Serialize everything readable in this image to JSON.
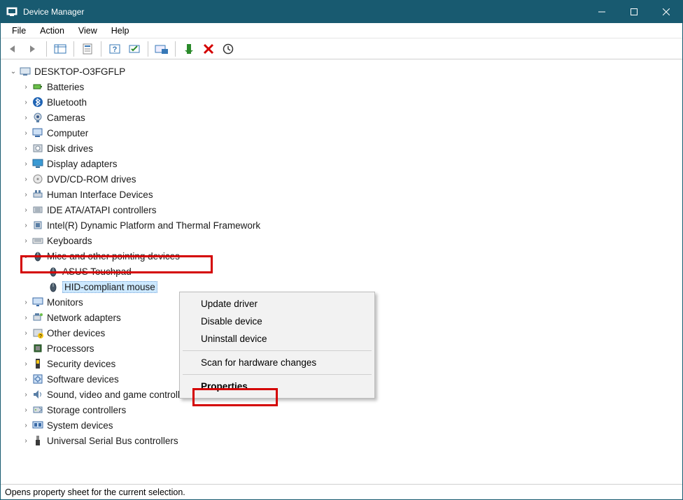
{
  "window": {
    "title": "Device Manager"
  },
  "menu": [
    "File",
    "Action",
    "View",
    "Help"
  ],
  "statusbar": "Opens property sheet for the current selection.",
  "root": {
    "label": "DESKTOP-O3FGFLP",
    "expanded": true
  },
  "categories": [
    {
      "label": "Batteries",
      "icon": "battery"
    },
    {
      "label": "Bluetooth",
      "icon": "bluetooth"
    },
    {
      "label": "Cameras",
      "icon": "camera"
    },
    {
      "label": "Computer",
      "icon": "computer"
    },
    {
      "label": "Disk drives",
      "icon": "disk"
    },
    {
      "label": "Display adapters",
      "icon": "display"
    },
    {
      "label": "DVD/CD-ROM drives",
      "icon": "dvd"
    },
    {
      "label": "Human Interface Devices",
      "icon": "hid"
    },
    {
      "label": "IDE ATA/ATAPI controllers",
      "icon": "ide"
    },
    {
      "label": "Intel(R) Dynamic Platform and Thermal Framework",
      "icon": "chip"
    },
    {
      "label": "Keyboards",
      "icon": "keyboard"
    },
    {
      "label": "Mice and other pointing devices",
      "icon": "mouse",
      "expanded": true,
      "highlighted": true,
      "children": [
        {
          "label": "ASUS Touchpad",
          "icon": "mouse"
        },
        {
          "label": "HID-compliant mouse",
          "icon": "mouse",
          "selected": true
        }
      ]
    },
    {
      "label": "Monitors",
      "icon": "monitor"
    },
    {
      "label": "Network adapters",
      "icon": "network"
    },
    {
      "label": "Other devices",
      "icon": "other"
    },
    {
      "label": "Processors",
      "icon": "cpu"
    },
    {
      "label": "Security devices",
      "icon": "security"
    },
    {
      "label": "Software devices",
      "icon": "software"
    },
    {
      "label": "Sound, video and game controllers",
      "icon": "sound"
    },
    {
      "label": "Storage controllers",
      "icon": "storage"
    },
    {
      "label": "System devices",
      "icon": "system"
    },
    {
      "label": "Universal Serial Bus controllers",
      "icon": "usb"
    }
  ],
  "context_menu": {
    "items": [
      {
        "label": "Update driver"
      },
      {
        "label": "Disable device"
      },
      {
        "label": "Uninstall device"
      },
      {
        "separator": true
      },
      {
        "label": "Scan for hardware changes"
      },
      {
        "separator": true
      },
      {
        "label": "Properties",
        "bold": true,
        "highlighted": true
      }
    ]
  }
}
